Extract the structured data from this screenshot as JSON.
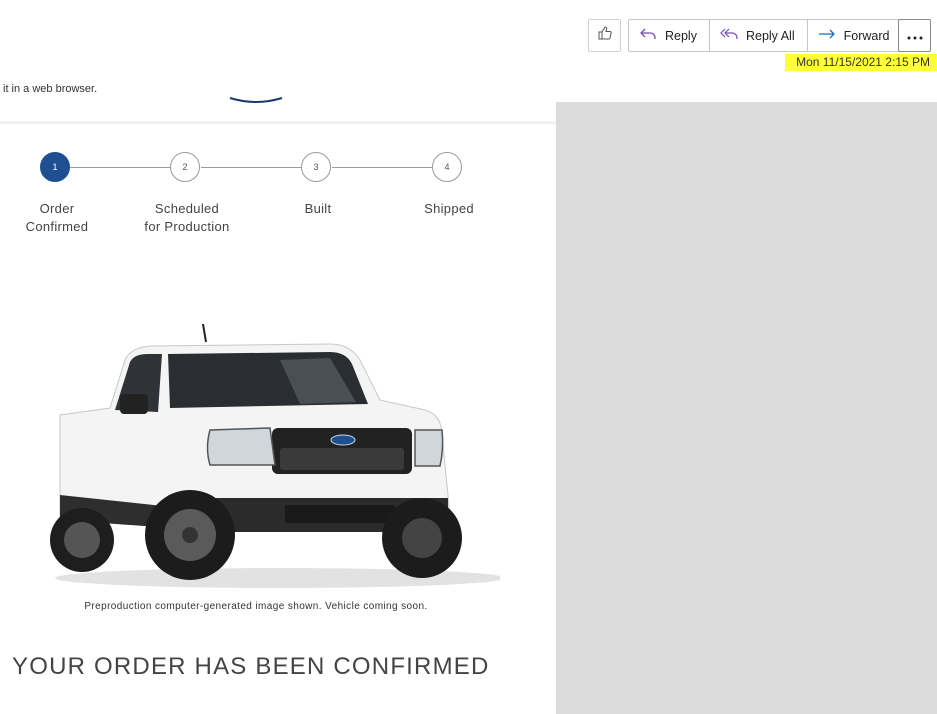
{
  "toolbar": {
    "like_icon": "thumbs-up-icon",
    "reply_label": "Reply",
    "reply_all_label": "Reply All",
    "forward_label": "Forward",
    "more_icon": "more-options-icon"
  },
  "date": "Mon 11/15/2021 2:15 PM",
  "web_note": "it in a web browser.",
  "steps": [
    {
      "number": "1",
      "label_line1": "Order",
      "label_line2": "Confirmed",
      "active": true
    },
    {
      "number": "2",
      "label_line1": "Scheduled",
      "label_line2": "for Production",
      "active": false
    },
    {
      "number": "3",
      "label_line1": "Built",
      "label_line2": "",
      "active": false
    },
    {
      "number": "4",
      "label_line1": "Shipped",
      "label_line2": "",
      "active": false
    }
  ],
  "caption": "Preproduction computer-generated image shown. Vehicle coming soon.",
  "headline": "YOUR ORDER HAS BEEN CONFIRMED",
  "colors": {
    "highlight": "#ffff3a",
    "step_active": "#1d4f91",
    "pane_gray": "#dbdbdb"
  }
}
